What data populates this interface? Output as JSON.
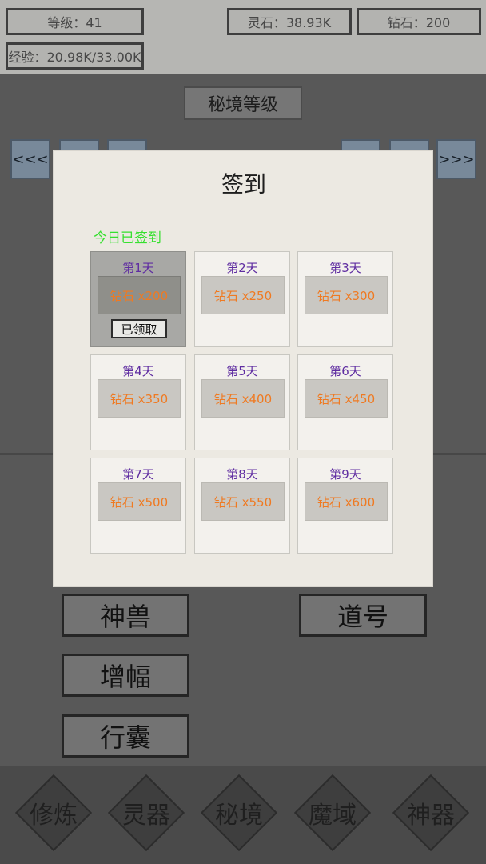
{
  "header": {
    "level": "等级：41",
    "spirit_stone": "灵石：38.93K",
    "diamond": "钻石：200",
    "experience": "经验：20.98K/33.00K"
  },
  "background": {
    "title": "秘境等级",
    "prev": "<<<",
    "next": ">>>",
    "feature_buttons": [
      "神兽",
      "道号",
      "增幅",
      "行囊"
    ]
  },
  "modal": {
    "title": "签到",
    "status": "今日已签到",
    "claimed_button": "已领取",
    "days": [
      {
        "day": "第1天",
        "reward": "钻石 x200",
        "claimed": true
      },
      {
        "day": "第2天",
        "reward": "钻石 x250",
        "claimed": false
      },
      {
        "day": "第3天",
        "reward": "钻石 x300",
        "claimed": false
      },
      {
        "day": "第4天",
        "reward": "钻石 x350",
        "claimed": false
      },
      {
        "day": "第5天",
        "reward": "钻石 x400",
        "claimed": false
      },
      {
        "day": "第6天",
        "reward": "钻石 x450",
        "claimed": false
      },
      {
        "day": "第7天",
        "reward": "钻石 x500",
        "claimed": false
      },
      {
        "day": "第8天",
        "reward": "钻石 x550",
        "claimed": false
      },
      {
        "day": "第9天",
        "reward": "钻石 x600",
        "claimed": false
      }
    ]
  },
  "bottom_nav": [
    "修炼",
    "灵器",
    "秘境",
    "魔域",
    "神器"
  ],
  "colors": {
    "status_text": "#36e02f",
    "day_text": "#5f2da1",
    "reward_text": "#ef7a22"
  }
}
